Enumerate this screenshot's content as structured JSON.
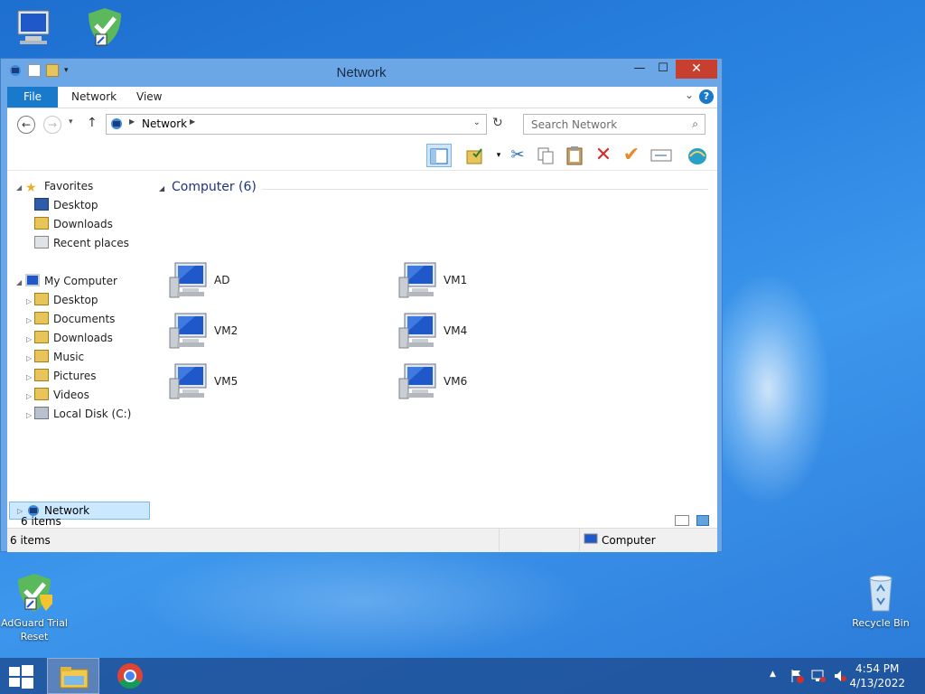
{
  "desktop": {
    "icons": [
      {
        "label": "My Computer"
      },
      {
        "label": "AdGuard"
      },
      {
        "label": "AdGuard Trial Reset"
      },
      {
        "label": "Recycle Bin"
      }
    ]
  },
  "window": {
    "title": "Network",
    "tabs": {
      "file": "File",
      "network": "Network",
      "view": "View"
    },
    "address": {
      "crumb": "Network"
    },
    "search": {
      "placeholder": "Search Network"
    },
    "nav": {
      "favorites": "Favorites",
      "fav_items": [
        "Desktop",
        "Downloads",
        "Recent places"
      ],
      "my_computer": "My Computer",
      "pc_items": [
        "Desktop",
        "Documents",
        "Downloads",
        "Music",
        "Pictures",
        "Videos",
        "Local Disk (C:)"
      ],
      "network": "Network"
    },
    "group_title": "Computer (6)",
    "computers": [
      "AD",
      "VM1",
      "VM2",
      "VM4",
      "VM5",
      "VM6"
    ],
    "inner_status": "6 items",
    "status": {
      "left": "6 items",
      "right": "Computer"
    }
  },
  "taskbar": {
    "time": "4:54 PM",
    "date": "4/13/2022"
  },
  "colors": {
    "accent": "#1979ca",
    "close": "#c7402f",
    "group": "#1e3287"
  }
}
